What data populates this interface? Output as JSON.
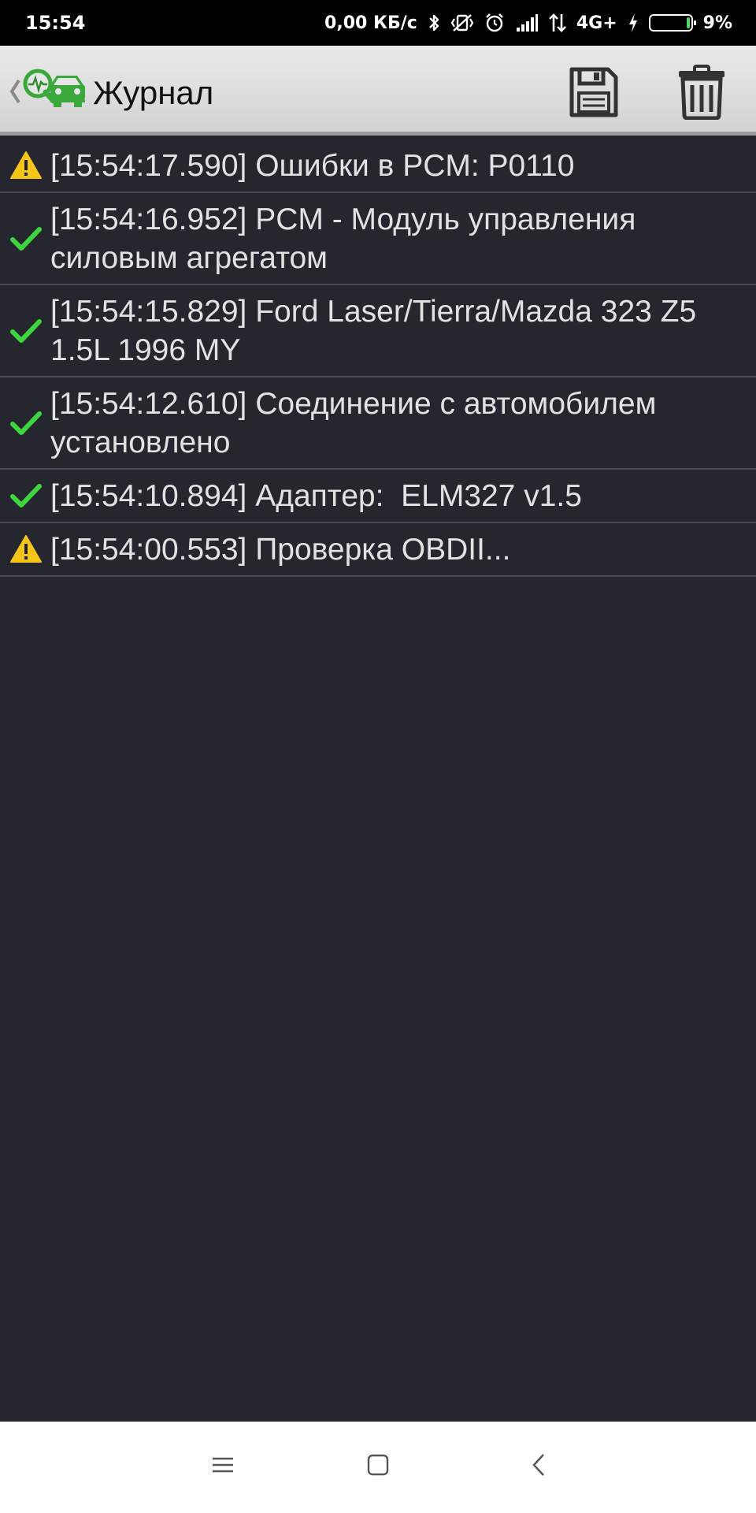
{
  "status_bar": {
    "time": "15:54",
    "network_speed": "0,00 КБ/с",
    "network_type": "4G+",
    "battery_percent": "9%",
    "battery_level": 0.09,
    "icons": [
      "bluetooth-icon",
      "vibrate-icon",
      "alarm-icon",
      "signal-icon",
      "data-arrows-icon",
      "charging-icon",
      "battery-icon"
    ]
  },
  "app_bar": {
    "title": "Журнал",
    "icons": [
      "back-chevron-icon",
      "car-diagnostic-logo-icon",
      "save-icon",
      "trash-icon"
    ]
  },
  "colors": {
    "background": "#25262e",
    "row_divider": "#484a52",
    "text": "#e2e2e2",
    "success": "#3ed63e",
    "warning": "#f5c518"
  },
  "log": [
    {
      "status": "warning",
      "icon": "warning-icon",
      "text": "[15:54:17.590] Ошибки в PCM: P0110"
    },
    {
      "status": "success",
      "icon": "checkmark-icon",
      "text": "[15:54:16.952] PCM - Модуль управления силовым агрегатом"
    },
    {
      "status": "success",
      "icon": "checkmark-icon",
      "text": "[15:54:15.829] Ford Laser/Tierra/Mazda 323 Z5 1.5L 1996 MY"
    },
    {
      "status": "success",
      "icon": "checkmark-icon",
      "text": "[15:54:12.610] Соединение с автомобилем установлено"
    },
    {
      "status": "success",
      "icon": "checkmark-icon",
      "text": "[15:54:10.894] Адаптер:  ELM327 v1.5"
    },
    {
      "status": "warning",
      "icon": "warning-icon",
      "text": "[15:54:00.553] Проверка OBDII..."
    }
  ],
  "nav_bar": {
    "icons": [
      "menu-icon",
      "home-icon",
      "back-icon"
    ]
  }
}
